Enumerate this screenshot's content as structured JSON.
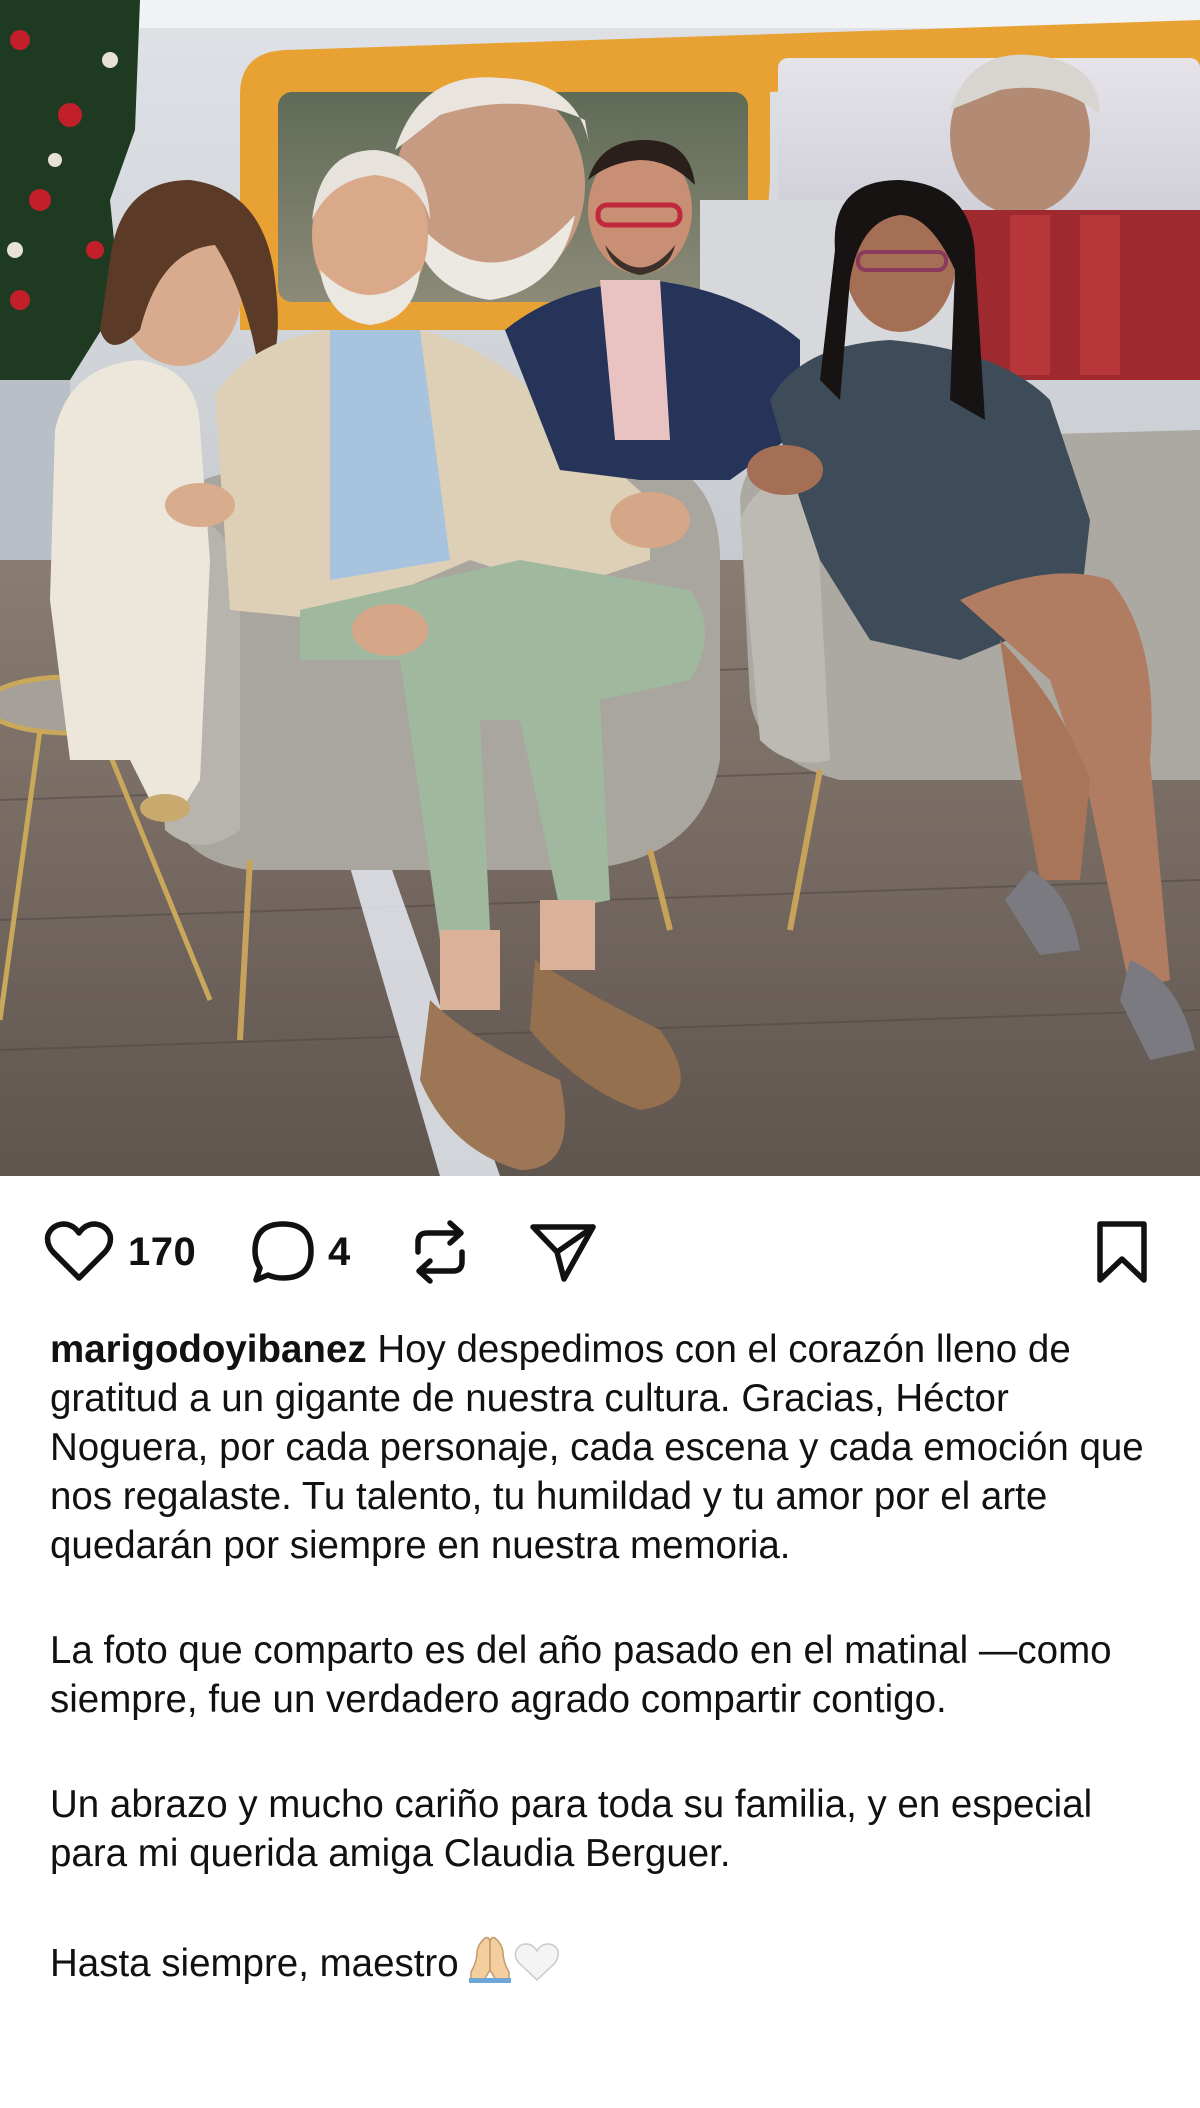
{
  "post": {
    "image_alt": "Four people posing on grey armchairs on a TV studio set",
    "likes_count": "170",
    "comments_count": "4"
  },
  "icons": {
    "like": "heart-outline-icon",
    "comment": "speech-bubble-icon",
    "repost": "repost-arrows-icon",
    "share": "paper-plane-icon",
    "save": "bookmark-outline-icon"
  },
  "caption": {
    "username": "marigodoyibanez",
    "first_text": "Hoy despedimos con el corazón lleno de gratitud a un gigante de nuestra cultura. Gracias, Héctor Noguera, por cada personaje, cada escena y cada emoción que nos regalaste. Tu talento, tu humildad y tu amor por el arte quedarán por siempre en nuestra memoria.",
    "paragraph_2": "La foto que comparto es del año pasado en el matinal —como siempre, fue un verdadero agrado compartir contigo.",
    "paragraph_3": "Un abrazo y mucho cariño para toda su familia, y en especial para mi querida amiga Claudia Berguer.",
    "paragraph_4": "Hasta siempre, maestro",
    "emojis": [
      "praying-hands",
      "white-heart"
    ]
  },
  "colors": {
    "text": "#111111",
    "background": "#ffffff",
    "studio_orange": "#e8a233",
    "sofa_grey": "#a9a59f"
  }
}
